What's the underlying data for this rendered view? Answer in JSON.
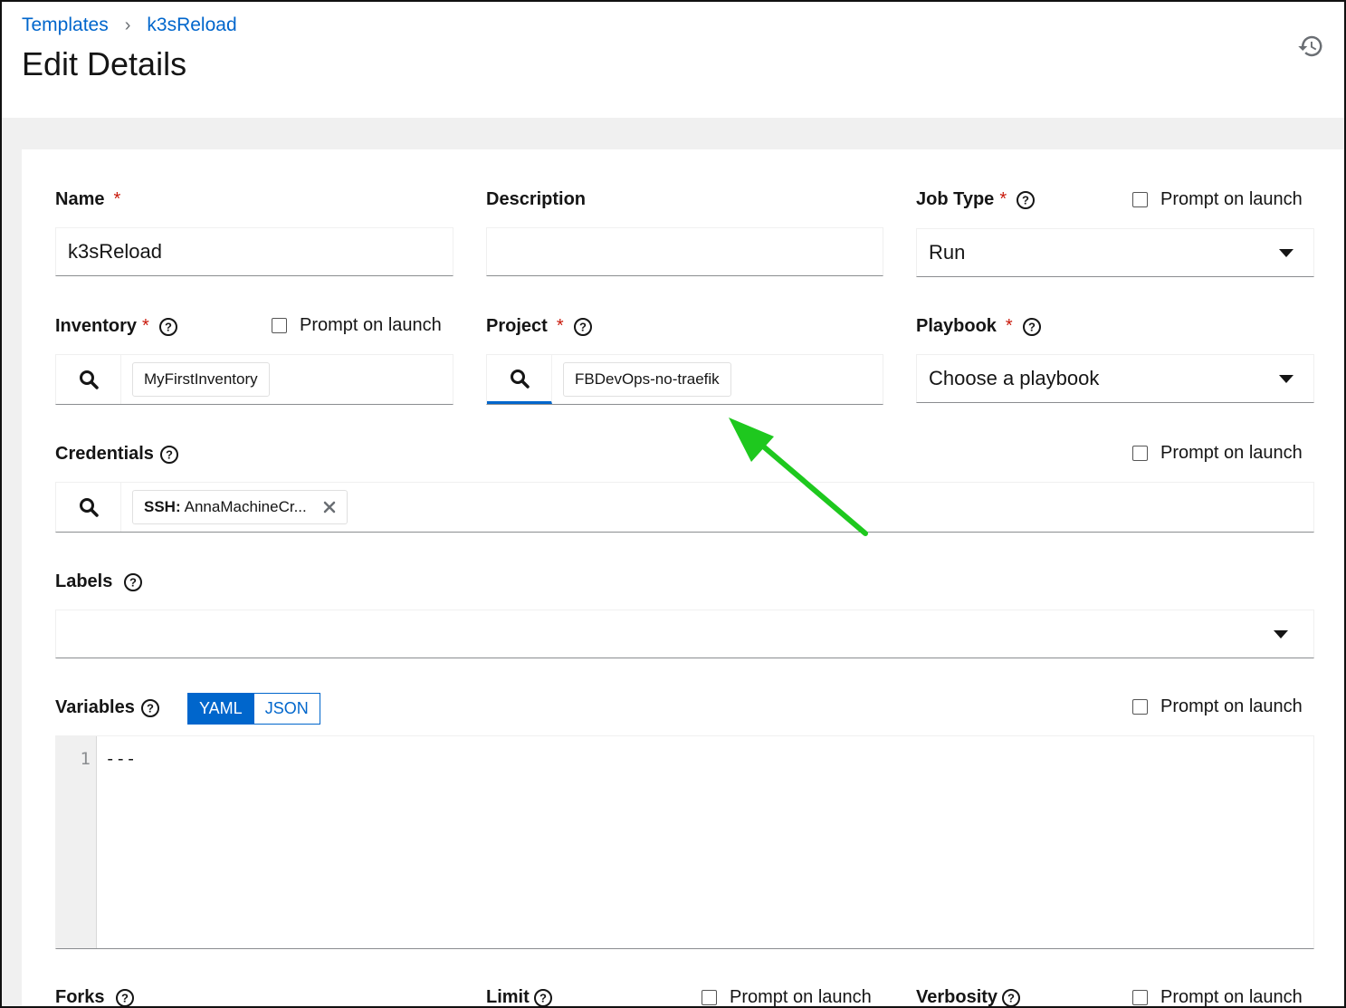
{
  "breadcrumb": {
    "parent": "Templates",
    "current": "k3sReload"
  },
  "page_title": "Edit Details",
  "fields": {
    "name": {
      "label": "Name",
      "required_mark": "*",
      "value": "k3sReload"
    },
    "description": {
      "label": "Description",
      "value": ""
    },
    "job_type": {
      "label": "Job Type",
      "required_mark": "*",
      "value": "Run",
      "prompt": "Prompt on launch"
    },
    "inventory": {
      "label": "Inventory",
      "required_mark": "*",
      "chip": "MyFirstInventory",
      "prompt": "Prompt on launch"
    },
    "project": {
      "label": "Project",
      "required_mark": "*",
      "chip": "FBDevOps-no-traefik"
    },
    "playbook": {
      "label": "Playbook",
      "required_mark": "*",
      "placeholder": "Choose a playbook"
    },
    "credentials": {
      "label": "Credentials",
      "chip_type": "SSH:",
      "chip_name": "AnnaMachineCr...",
      "prompt": "Prompt on launch"
    },
    "labels": {
      "label": "Labels"
    },
    "variables": {
      "label": "Variables",
      "mode_yaml": "YAML",
      "mode_json": "JSON",
      "prompt": "Prompt on launch",
      "line_number": "1",
      "content": "---"
    },
    "forks": {
      "label": "Forks"
    },
    "limit": {
      "label": "Limit",
      "prompt": "Prompt on launch"
    },
    "verbosity": {
      "label": "Verbosity",
      "prompt": "Prompt on launch"
    }
  },
  "colors": {
    "link": "#0066cc",
    "required": "#c9190b",
    "annotation_arrow": "#1ec81e",
    "page_bg": "#f0f0f0"
  },
  "icons": [
    "history-icon",
    "help-icon",
    "search-icon",
    "caret-down-icon",
    "close-icon"
  ]
}
